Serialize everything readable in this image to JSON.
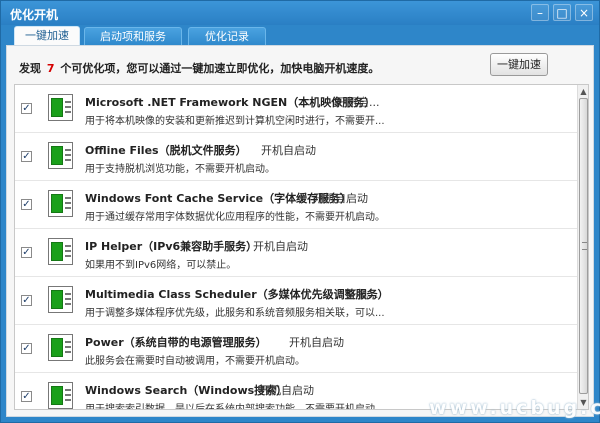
{
  "window": {
    "title": "优化开机",
    "minimize_glyph": "–",
    "maximize_glyph": "□",
    "close_glyph": "×"
  },
  "tabs": [
    {
      "label": "一键加速",
      "active": true
    },
    {
      "label": "启动项和服务",
      "active": false
    },
    {
      "label": "优化记录",
      "active": false
    }
  ],
  "summary": {
    "prefix": "发现",
    "count": "7",
    "suffix": "个可优化项，您可以通过一键加速立即优化，加快电脑开机速度。"
  },
  "boost_button": "一键加速",
  "items": [
    {
      "checked": true,
      "title": "Microsoft .NET Framework NGEN（本机映像服务）",
      "status": "开机自...",
      "description": "用于将本机映像的安装和更新推迟到计算机空闲时进行，不需要开..."
    },
    {
      "checked": true,
      "title": "Offline Files（脱机文件服务）",
      "status": "开机自启动",
      "description": "用于支持脱机浏览功能，不需要开机启动。"
    },
    {
      "checked": true,
      "title": "Windows Font Cache Service（字体缓存服务）",
      "status": "开机自启动",
      "description": "用于通过缓存常用字体数据优化应用程序的性能，不需要开机启动。"
    },
    {
      "checked": true,
      "title": "IP Helper（IPv6兼容助手服务）",
      "status": "开机自启动",
      "description": "如果用不到IPv6网络，可以禁止。"
    },
    {
      "checked": true,
      "title": "Multimedia Class Scheduler（多媒体优先级调整服务）",
      "status": "开机...",
      "description": "用于调整多媒体程序优先级，此服务和系统音频服务相关联，可以..."
    },
    {
      "checked": true,
      "title": "Power（系统自带的电源管理服务）",
      "status": "开机自启动",
      "description": "此服务会在需要时自动被调用，不需要开机启动。"
    },
    {
      "checked": true,
      "title": "Windows Search（Windows搜索）",
      "status": "开机自启动",
      "description": "用于搜索索引数据，是以后在系统内部搜索功能，不需要开机启动"
    }
  ],
  "checkbox_glyph": "✓",
  "scrollbar": {
    "up_glyph": "▲",
    "down_glyph": "▼"
  },
  "watermark": "www.ucbug.cc",
  "colors": {
    "titlebar": "#2e86c9",
    "count_highlight": "#d40000",
    "icon_green": "#1aa01a"
  }
}
